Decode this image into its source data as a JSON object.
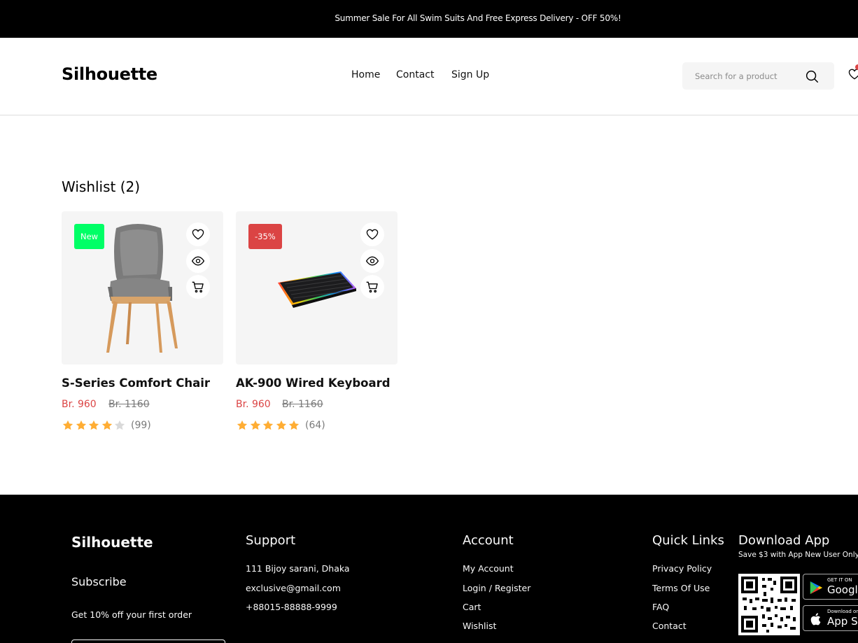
{
  "top_banner": {
    "message": "Summer Sale For All Swim Suits And Free Express Delivery - OFF 50%!"
  },
  "header": {
    "logo": "Silhouette",
    "nav": {
      "home": "Home",
      "contact": "Contact",
      "signup": "Sign Up"
    },
    "search_placeholder": "Search for a product",
    "icons": [
      "search-icon",
      "heart-icon"
    ]
  },
  "wishlist": {
    "title": "Wishlist (2)",
    "products": [
      {
        "name": "S-Series Comfort Chair",
        "price": "Br. 960",
        "old_price": "Br. 1160",
        "badge": "New",
        "rating": 4,
        "reviews": "(99)",
        "image": "chair-image"
      },
      {
        "name": "AK-900 Wired Keyboard",
        "price": "Br. 960",
        "old_price": "Br. 1160",
        "badge": "-35%",
        "rating": 5,
        "reviews": "(64)",
        "image": "keyboard-image"
      }
    ]
  },
  "footer": {
    "logo": "Silhouette",
    "subscribe": "Subscribe",
    "offer": "Get 10% off your first order",
    "support": {
      "title": "Support",
      "address": "111 Bijoy sarani, Dhaka",
      "email": "exclusive@gmail.com",
      "phone": "+88015-88888-9999"
    },
    "account": {
      "title": "Account",
      "links": [
        "My Account",
        "Login / Register",
        "Cart",
        "Wishlist"
      ]
    },
    "quick_links": {
      "title": "Quick Links",
      "links": [
        "Privacy Policy",
        "Terms Of Use",
        "FAQ",
        "Contact"
      ]
    },
    "download": {
      "title": "Download App",
      "note": "Save $3 with App New User Only",
      "google": {
        "small": "GET IT ON",
        "big": "Google Play"
      },
      "apple": {
        "small": "Download on the",
        "big": "App Store"
      }
    }
  },
  "colors": {
    "accent": "#DB4444",
    "new_badge": "#00FF66",
    "star": "#FFAD33",
    "star_empty": "#D9D9D9",
    "card_bg": "#F5F5F5"
  }
}
